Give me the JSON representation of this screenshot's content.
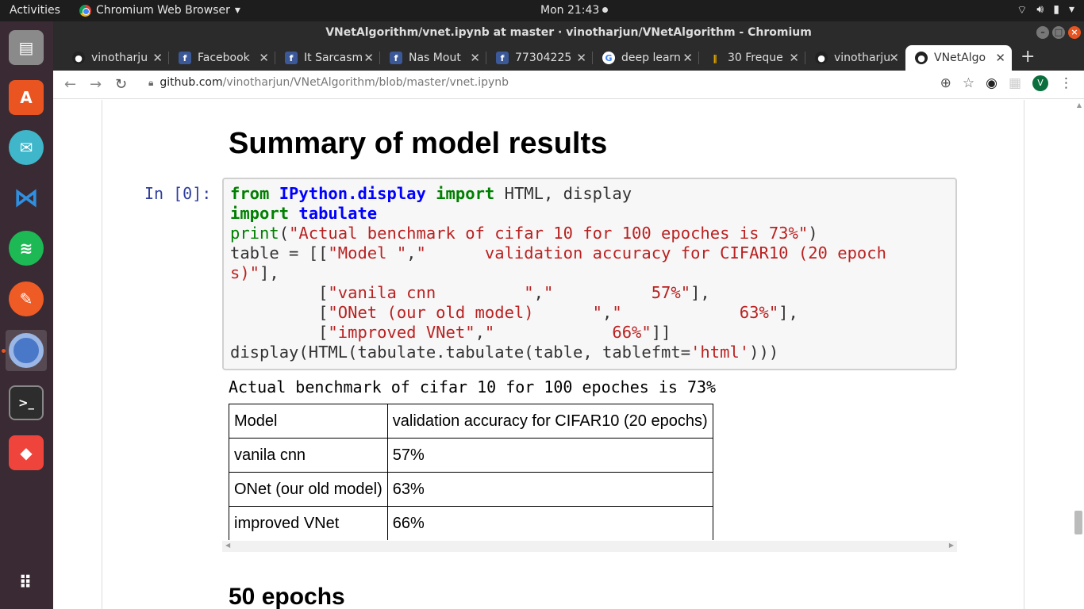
{
  "topbar": {
    "activities": "Activities",
    "app_menu": "Chromium Web Browser",
    "clock": "Mon 21:43"
  },
  "window": {
    "title": "VNetAlgorithm/vnet.ipynb at master · vinotharjun/VNetAlgorithm - Chromium"
  },
  "tabs": [
    {
      "label": "vinotharju",
      "icon": "github-icon"
    },
    {
      "label": "Facebook",
      "icon": "facebook-icon"
    },
    {
      "label": "It Sarcasm",
      "icon": "facebook-icon"
    },
    {
      "label": "Nas Mout",
      "icon": "facebook-icon"
    },
    {
      "label": "77304225",
      "icon": "facebook-icon"
    },
    {
      "label": "deep learn",
      "icon": "google-icon"
    },
    {
      "label": "30 Freque",
      "icon": "blog-icon"
    },
    {
      "label": "vinotharju",
      "icon": "github-icon"
    },
    {
      "label": "VNetAlgo",
      "icon": "github-icon",
      "active": true
    }
  ],
  "toolbar": {
    "url_host": "github.com",
    "url_path": "/vinotharjun/VNetAlgorithm/blob/master/vnet.ipynb",
    "avatar_letter": "V"
  },
  "notebook": {
    "heading": "Summary of model results",
    "prompt": "In [0]:",
    "stdout": "Actual benchmark of cifar 10 for 100 epoches is 73%",
    "table": [
      [
        "Model",
        "validation accuracy for CIFAR10 (20 epochs)"
      ],
      [
        "vanila cnn",
        "57%"
      ],
      [
        "ONet (our old model)",
        "63%"
      ],
      [
        "improved VNet",
        "66%"
      ]
    ],
    "next_heading": "50 epochs"
  },
  "colors": {
    "dock_bg": "#3a2a33",
    "titlebar_bg": "#2b2b2b",
    "prompt_color": "#303f9f",
    "keyword_color": "#008000",
    "string_color": "#ba2121"
  }
}
